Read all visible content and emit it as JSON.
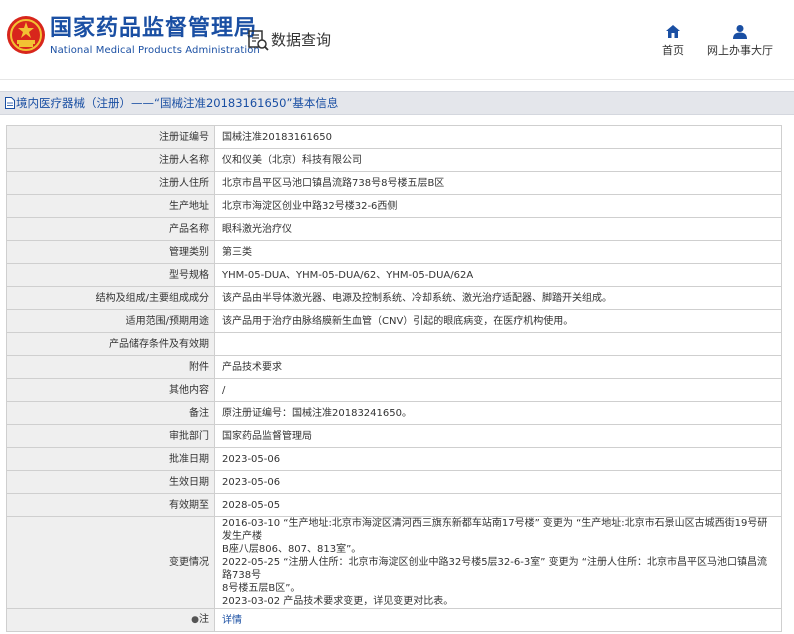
{
  "header": {
    "brand_cn": "国家药品监督管理局",
    "brand_en": "National Medical Products Administration",
    "query_label": "数据查询",
    "nav": {
      "home": "首页",
      "office": "网上办事大厅"
    }
  },
  "section": {
    "title": "境内医疗器械（注册）——“国械注准20183161650”基本信息"
  },
  "table": {
    "rows": [
      {
        "label": "注册证编号",
        "value": "国械注准20183161650"
      },
      {
        "label": "注册人名称",
        "value": "仪和仪美（北京）科技有限公司"
      },
      {
        "label": "注册人住所",
        "value": "北京市昌平区马池口镇昌流路738号8号楼五层B区"
      },
      {
        "label": "生产地址",
        "value": "北京市海淀区创业中路32号楼32-6西侧"
      },
      {
        "label": "产品名称",
        "value": "眼科激光治疗仪"
      },
      {
        "label": "管理类别",
        "value": "第三类"
      },
      {
        "label": "型号规格",
        "value": "YHM-05-DUA、YHM-05-DUA/62、YHM-05-DUA/62A"
      },
      {
        "label": "结构及组成/主要组成成分",
        "value": "该产品由半导体激光器、电源及控制系统、冷却系统、激光治疗适配器、脚踏开关组成。"
      },
      {
        "label": "适用范围/预期用途",
        "value": "该产品用于治疗由脉络膜新生血管（CNV）引起的眼底病变，在医疗机构使用。"
      },
      {
        "label": "产品储存条件及有效期",
        "value": ""
      },
      {
        "label": "附件",
        "value": "产品技术要求"
      },
      {
        "label": "其他内容",
        "value": "/"
      },
      {
        "label": "备注",
        "value": "原注册证编号：国械注准20183241650。"
      },
      {
        "label": "审批部门",
        "value": "国家药品监督管理局"
      },
      {
        "label": "批准日期",
        "value": "2023-05-06"
      },
      {
        "label": "生效日期",
        "value": "2023-05-06"
      },
      {
        "label": "有效期至",
        "value": "2028-05-05"
      }
    ],
    "change": {
      "label": "变更情况",
      "lines": [
        "2016-03-10 “生产地址:北京市海淀区清河西三旗东新都车站南17号楼” 变更为 “生产地址:北京市石景山区古城西街19号研发生产楼",
        "B座八层806、807、813室”。",
        "2022-05-25 “注册人住所：北京市海淀区创业中路32号楼5层32-6-3室” 变更为 “注册人住所：北京市昌平区马池口镇昌流路738号",
        "8号楼五层B区”。",
        "2023-03-02 产品技术要求变更，详见变更对比表。"
      ]
    },
    "note": {
      "label": "注",
      "value": "详情"
    }
  },
  "colors": {
    "brand_blue": "#1a4fa3",
    "label_bg": "#efefef",
    "border": "#cfcfcf",
    "section_bg": "#e4e6eb"
  }
}
